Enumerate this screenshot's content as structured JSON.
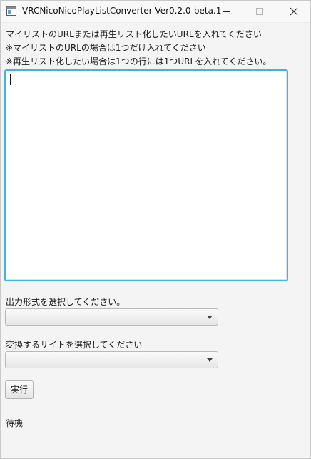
{
  "window": {
    "title": "VRCNicoNicoPlayListConverter Ver0.2.0-beta.1",
    "icon": "app-window-icon",
    "controls": {
      "minimize": "minimize-icon",
      "maximize": "maximize-icon",
      "close": "close-icon"
    }
  },
  "instructions": {
    "line1": "マイリストのURLまたは再生リスト化したいURLを入れてください",
    "line2": "※マイリストのURLの場合は1つだけ入れてください",
    "line3": "※再生リスト化したい場合は1つの行には1つURLを入れてください。"
  },
  "url_input": {
    "value": "",
    "focused": true,
    "accent_color": "#3fb4de"
  },
  "output_format": {
    "label": "出力形式を選択してください。",
    "selected": ""
  },
  "site_select": {
    "label": "変換するサイトを選択してください",
    "selected": ""
  },
  "run_button": {
    "label": "実行"
  },
  "status": {
    "text": "待機"
  }
}
